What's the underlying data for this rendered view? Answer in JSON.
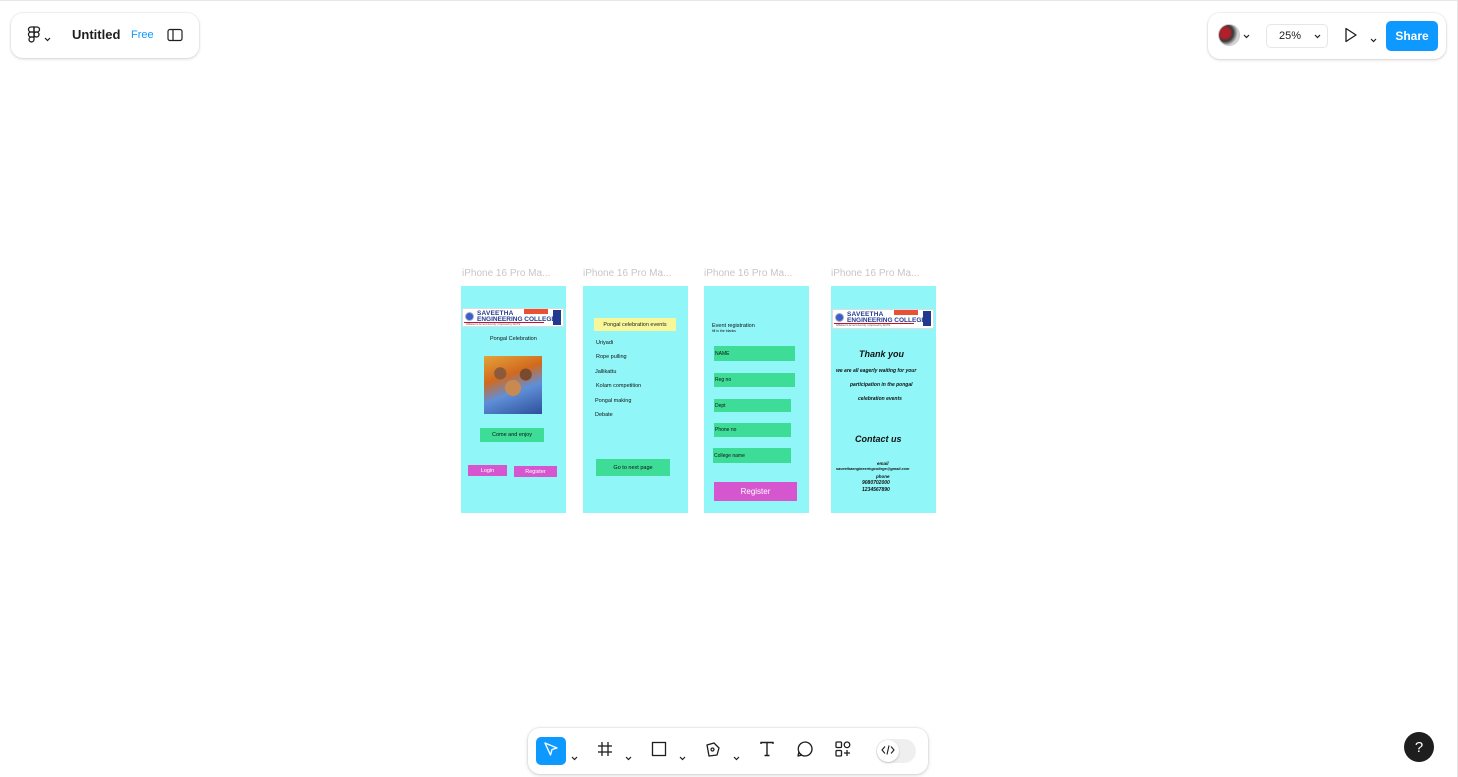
{
  "app": {
    "file_title": "Untitled",
    "plan_badge": "Free",
    "zoom": "25%",
    "share_label": "Share",
    "help_label": "?"
  },
  "icons": [
    "figma-menu-icon",
    "sidebar-toggle-icon",
    "play-icon",
    "move-tool-icon",
    "frame-tool-icon",
    "rectangle-tool-icon",
    "pen-tool-icon",
    "text-tool-icon",
    "comment-icon",
    "components-icon",
    "code-icon"
  ],
  "colors": {
    "accent": "#0d99ff",
    "frame_bg": "#91f6f8",
    "green": "#3ddc97",
    "pink": "#d656cf"
  },
  "frames": [
    {
      "label": "iPhone 16 Pro Ma...",
      "logo_line1": "SAVEETHA",
      "logo_line2": "ENGINEERING COLLEGE",
      "logo_tagline": "Affiliated to Anna University | Approved by AICTE",
      "heading": "Pongal Celebration",
      "cta": "Come and enjoy",
      "login": "Login",
      "register": "Register"
    },
    {
      "label": "iPhone 16 Pro Ma...",
      "heading": "Pongal celebration events",
      "events": [
        "Uriyadi",
        "Rope pulling",
        "Jallikattu",
        "Kolam competition",
        "Pongal making",
        "Debate"
      ],
      "next": "Go to next page"
    },
    {
      "label": "iPhone 16 Pro Ma...",
      "heading": "Event registration",
      "subheading": "fill in the blanks",
      "fields": [
        "NAME",
        "Reg no",
        "Dept",
        "Phone no",
        "College name"
      ],
      "register": "Register"
    },
    {
      "label": "iPhone 16 Pro Ma...",
      "logo_line1": "SAVEETHA",
      "logo_line2": "ENGINEERING COLLEGE",
      "logo_tagline": "Affiliated to Anna University | Approved by AICTE",
      "thank_you": "Thank you",
      "message_1": "we are all eagerly waiting for your",
      "message_2": "participation in the pongal",
      "message_3": "celebration events",
      "contact_heading": "Contact us",
      "email_label": "email",
      "email": "saveethaengineeringcollege@gmail.com",
      "phone_label": "phone",
      "phone_1": "9080702000",
      "phone_2": "1234567890"
    }
  ]
}
